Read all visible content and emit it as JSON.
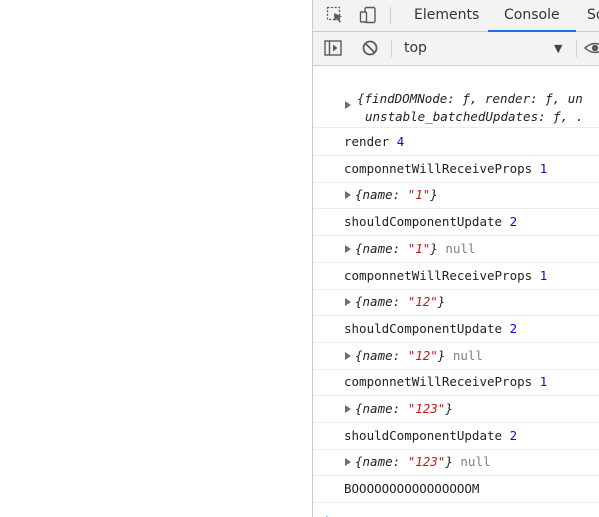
{
  "tabs": [
    {
      "label": "Elements",
      "active": false
    },
    {
      "label": "Console",
      "active": true
    },
    {
      "label": "So",
      "active": false
    }
  ],
  "toolbar": {
    "context": "top"
  },
  "console": {
    "first_object": {
      "line1": "{findDOMNode: ƒ, render: ƒ, un",
      "line2": "unstable_batchedUpdates: ƒ, ."
    },
    "rows": [
      {
        "kind": "log",
        "text": "render",
        "num": "4"
      },
      {
        "kind": "log",
        "text": "componnetWillReceiveProps",
        "num": "1"
      },
      {
        "kind": "obj",
        "prefix": "{name: ",
        "value": "\"1\"",
        "suffix": "}",
        "extra": ""
      },
      {
        "kind": "log",
        "text": "shouldComponentUpdate",
        "num": "2"
      },
      {
        "kind": "obj",
        "prefix": "{name: ",
        "value": "\"1\"",
        "suffix": "}",
        "extra": "null"
      },
      {
        "kind": "log",
        "text": "componnetWillReceiveProps",
        "num": "1"
      },
      {
        "kind": "obj",
        "prefix": "{name: ",
        "value": "\"12\"",
        "suffix": "}",
        "extra": ""
      },
      {
        "kind": "log",
        "text": "shouldComponentUpdate",
        "num": "2"
      },
      {
        "kind": "obj",
        "prefix": "{name: ",
        "value": "\"12\"",
        "suffix": "}",
        "extra": "null"
      },
      {
        "kind": "log",
        "text": "componnetWillReceiveProps",
        "num": "1"
      },
      {
        "kind": "obj",
        "prefix": "{name: ",
        "value": "\"123\"",
        "suffix": "}",
        "extra": ""
      },
      {
        "kind": "log",
        "text": "shouldComponentUpdate",
        "num": "2"
      },
      {
        "kind": "obj",
        "prefix": "{name: ",
        "value": "\"123\"",
        "suffix": "}",
        "extra": "null"
      },
      {
        "kind": "log",
        "text": "BOOOOOOOOOOOOOOOOM",
        "num": ""
      }
    ],
    "prompt": "›"
  },
  "colors": {
    "string": "#c41a16",
    "number": "#1c00cf",
    "accent": "#1a73e8"
  },
  "icons": [
    "inspect-element-icon",
    "device-toolbar-icon",
    "sidebar-toggle-icon",
    "clear-console-icon",
    "dropdown-arrow-icon",
    "eye-icon"
  ]
}
